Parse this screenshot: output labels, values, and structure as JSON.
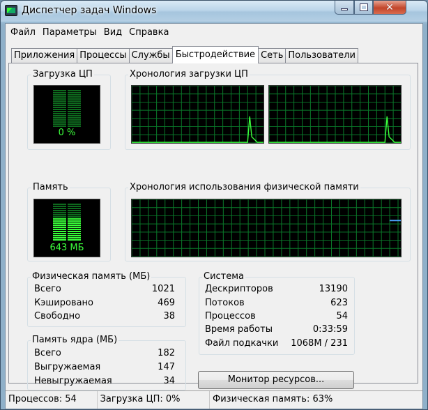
{
  "window": {
    "title": "Диспетчер задач Windows"
  },
  "menu": [
    "Файл",
    "Параметры",
    "Вид",
    "Справка"
  ],
  "tabs": [
    "Приложения",
    "Процессы",
    "Службы",
    "Быстродействие",
    "Сеть",
    "Пользователи"
  ],
  "active_tab": "Быстродействие",
  "cpu": {
    "usage_label": "Загрузка ЦП",
    "usage_value": "0 %",
    "usage_fraction": 0.0,
    "history_label": "Хронология загрузки ЦП"
  },
  "memory": {
    "label": "Память",
    "value": "643 МБ",
    "fill_fraction": 0.63,
    "history_label": "Хронология использования физической памяти"
  },
  "physical_memory": {
    "title": "Физическая память (МБ)",
    "rows": [
      {
        "label": "Всего",
        "value": "1021"
      },
      {
        "label": "Кэшировано",
        "value": "469"
      },
      {
        "label": "Свободно",
        "value": "38"
      }
    ]
  },
  "kernel_memory": {
    "title": "Память ядра (МБ)",
    "rows": [
      {
        "label": "Всего",
        "value": "182"
      },
      {
        "label": "Выгружаемая",
        "value": "147"
      },
      {
        "label": "Невыгружаемая",
        "value": "34"
      }
    ]
  },
  "system": {
    "title": "Система",
    "rows": [
      {
        "label": "Дескрипторов",
        "value": "13190"
      },
      {
        "label": "Потоков",
        "value": "623"
      },
      {
        "label": "Процессов",
        "value": "54"
      },
      {
        "label": "Время работы",
        "value": "0:33:59"
      },
      {
        "label": "Файл подкачки",
        "value": "1068M / 231"
      }
    ]
  },
  "resource_monitor_button": "Монитор ресурсов...",
  "status": {
    "processes": "Процессов: 54",
    "cpu": "Загрузка ЦП: 0%",
    "memory": "Физическая память: 63%"
  },
  "colors": {
    "graph_grid": "#0a7a2a",
    "graph_line": "#3cff3c",
    "memory_line": "#4ba3ff"
  }
}
